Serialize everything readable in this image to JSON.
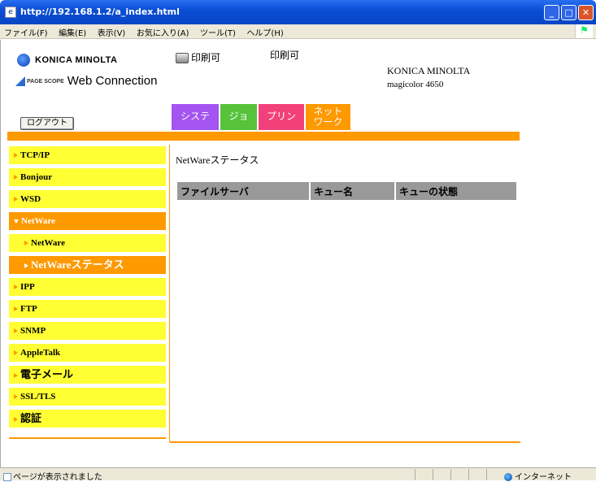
{
  "window": {
    "title": "http://192.168.1.2/a_index.html"
  },
  "menu": [
    "ファイル(F)",
    "編集(E)",
    "表示(V)",
    "お気に入り(A)",
    "ツール(T)",
    "ヘルプ(H)"
  ],
  "header": {
    "brand": "KONICA MINOLTA",
    "product_prefix": "PAGE SCOPE",
    "product": "Web Connection",
    "printer_status": "印刷可",
    "printer_status2": "印刷可",
    "company": "KONICA MINOLTA",
    "model": "magicolor 4650",
    "logout": "ログアウト"
  },
  "tabs": [
    {
      "label": "システム",
      "color": "#a454f0"
    },
    {
      "label": "ジョブ",
      "color": "#56c33a"
    },
    {
      "label": "プリント",
      "color": "#f2407a"
    },
    {
      "label": "ネットワーク",
      "color": "#ff9900"
    }
  ],
  "sidebar": {
    "items": [
      {
        "label": "TCP/IP"
      },
      {
        "label": "Bonjour"
      },
      {
        "label": "WSD"
      },
      {
        "label": "NetWare",
        "active": true
      },
      {
        "label": "NetWare",
        "sub": true
      },
      {
        "label": "NetWareステータス",
        "sub": true,
        "active": true
      },
      {
        "label": "IPP"
      },
      {
        "label": "FTP"
      },
      {
        "label": "SNMP"
      },
      {
        "label": "AppleTalk"
      },
      {
        "label": "電子メール"
      },
      {
        "label": "SSL/TLS"
      },
      {
        "label": "認証"
      }
    ]
  },
  "main": {
    "heading": "NetWareステータス",
    "table_headers": [
      "ファイルサーバ",
      "キュー名",
      "キューの状態"
    ]
  },
  "statusbar": {
    "text": "ページが表示されました",
    "zone": "インターネット"
  },
  "colors": {
    "accent": "#ff9900",
    "sidebar_bg": "#ffff33"
  }
}
